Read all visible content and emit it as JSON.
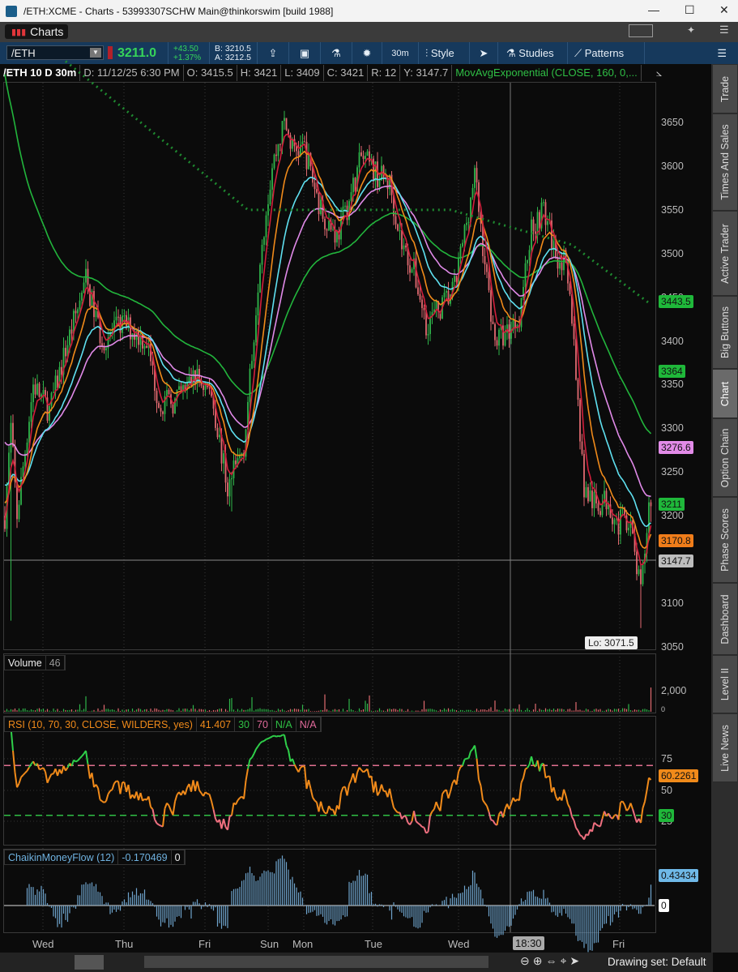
{
  "window": {
    "title": "/ETH:XCME - Charts - 53993307SCHW Main@thinkorswim [build 1988]",
    "minimize": "—",
    "maximize": "☐",
    "close": "✕"
  },
  "charts_tab": {
    "label": "Charts"
  },
  "toolbar": {
    "symbol": "/ETH",
    "last": "3211.0",
    "change": "+43.50",
    "change_pct": "+1.37%",
    "bid": "B: 3210.5",
    "ask": "A: 3212.5",
    "timeframe": "30m",
    "style": "Style",
    "studies": "Studies",
    "patterns": "Patterns"
  },
  "infobar": {
    "label": "/ETH 10 D 30m",
    "date": "D: 11/12/25 6:30 PM",
    "open": "O: 3415.5",
    "high": "H: 3421",
    "low": "L: 3409",
    "close": "C: 3421",
    "range": "R: 12",
    "y": "Y: 3147.7",
    "study": "MovAvgExponential (CLOSE, 160, 0,..."
  },
  "price_axis": {
    "ticks": [
      "3650",
      "3600",
      "3550",
      "3500",
      "3450",
      "3400",
      "3350",
      "3300",
      "3250",
      "3200",
      "3150",
      "3100",
      "3050"
    ],
    "labels": [
      {
        "text": "3443.5",
        "color": "#1fb83a"
      },
      {
        "text": "3364",
        "color": "#1fb83a"
      },
      {
        "text": "3276.6",
        "color": "#e28be8"
      },
      {
        "text": "3211",
        "color": "#1fb83a"
      },
      {
        "text": "3170.8",
        "color": "#f07d1a"
      },
      {
        "text": "3147.7",
        "color": "#bdbdbd"
      }
    ],
    "low_marker": "Lo: 3071.5"
  },
  "volume": {
    "title": "Volume",
    "value": "46",
    "tick_2000": "2,000",
    "tick_0": "0"
  },
  "rsi": {
    "title": "RSI (10, 70, 30, CLOSE, WILDERS, yes)",
    "value": "41.407",
    "os": "30",
    "ob": "70",
    "na1": "N/A",
    "na2": "N/A",
    "ticks": [
      "75",
      "50",
      "25"
    ],
    "label_value": "60.2261",
    "label_30": "30"
  },
  "cmf": {
    "title": "ChaikinMoneyFlow (12)",
    "value": "-0.170469",
    "zero": "0",
    "label_value": "0.43434",
    "label_zero": "0"
  },
  "x_axis": {
    "labels": [
      "Wed",
      "Thu",
      "Fri",
      "Sun",
      "Mon",
      "Tue",
      "Wed",
      "Fri"
    ],
    "cursor": "18:30"
  },
  "bottom": {
    "drawing_set": "Drawing set: Default"
  },
  "sidebar": {
    "tabs": [
      "Trade",
      "Times And Sales",
      "Active Trader",
      "Big Buttons",
      "Chart",
      "Option Chain",
      "Phase Scores",
      "Dashboard",
      "Level II",
      "Live News"
    ],
    "selected": "Chart"
  },
  "colors": {
    "up": "#2fb54a",
    "down": "#e06a70",
    "ema_red": "#d21f3c",
    "ema_orange": "#f08a1a",
    "ema_cyan": "#5fe0f0",
    "ema_violet": "#e08ae8",
    "ema_green": "#22b53c",
    "rsi": "#f08a1a",
    "cmf": "#6fa3cc"
  },
  "chart_data": {
    "type": "candlestick",
    "symbol": "/ETH",
    "interval": "30m",
    "days": 10,
    "ylim": [
      3050,
      3670
    ],
    "close_path": {
      "bar": [
        0,
        3,
        6,
        14,
        22,
        30,
        40,
        48,
        58,
        70,
        76,
        84,
        94,
        102,
        110,
        118,
        122,
        126,
        132,
        138,
        142,
        148,
        156,
        164,
        170,
        176,
        184,
        190,
        196,
        202,
        208,
        216,
        222,
        232,
        238,
        242,
        248,
        254,
        260,
        266,
        272,
        276,
        280,
        286,
        292,
        298,
        302,
        308,
        314,
        318
      ],
      "price": [
        3200,
        3300,
        3200,
        3350,
        3320,
        3390,
        3470,
        3400,
        3420,
        3400,
        3330,
        3330,
        3360,
        3340,
        3230,
        3280,
        3380,
        3500,
        3600,
        3650,
        3620,
        3620,
        3550,
        3520,
        3560,
        3610,
        3590,
        3580,
        3510,
        3480,
        3420,
        3440,
        3460,
        3590,
        3470,
        3400,
        3410,
        3430,
        3530,
        3550,
        3500,
        3490,
        3430,
        3230,
        3210,
        3220,
        3190,
        3200,
        3110,
        3211
      ]
    },
    "trend_line_dotted": {
      "bar": [
        30,
        120,
        220,
        280,
        318
      ],
      "price": [
        3720,
        3550,
        3550,
        3510,
        3443.5
      ]
    },
    "last_values": {
      "ema_long": 3443.5,
      "ema_green": 3364,
      "ema_violet": 3276.6,
      "close": 3211,
      "ema_orange": 3170.8,
      "cursor_price": 3147.7,
      "low": 3071.5,
      "rsi": 60.2261,
      "cmf": 0.43434
    }
  }
}
